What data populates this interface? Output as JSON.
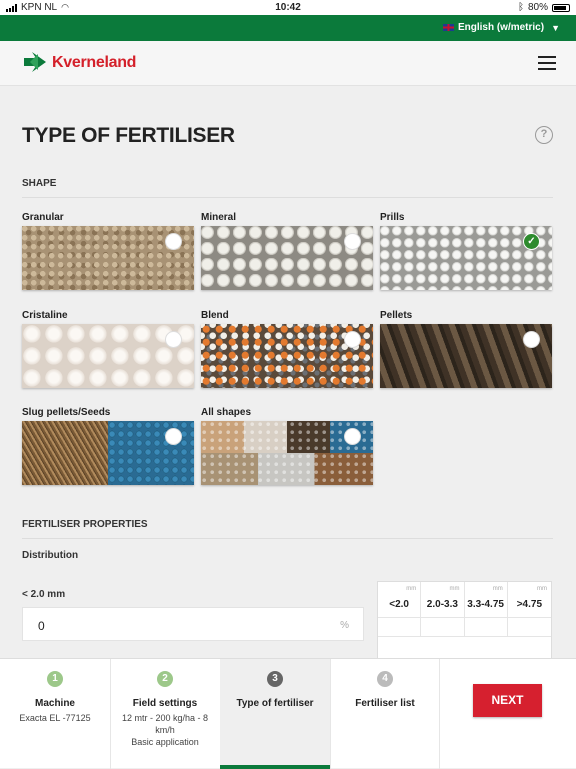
{
  "status_bar": {
    "carrier": "KPN NL",
    "time": "10:42",
    "battery": "80%"
  },
  "language": {
    "label": "English (w/metric)"
  },
  "brand": {
    "name": "Kverneland"
  },
  "page": {
    "title": "TYPE OF FERTILISER",
    "help": "?"
  },
  "shape_section": {
    "heading": "SHAPE",
    "options": [
      {
        "label": "Granular",
        "selected": false
      },
      {
        "label": "Mineral",
        "selected": false
      },
      {
        "label": "Prills",
        "selected": true
      },
      {
        "label": "Cristaline",
        "selected": false
      },
      {
        "label": "Blend",
        "selected": false
      },
      {
        "label": "Pellets",
        "selected": false
      },
      {
        "label": "Slug pellets/Seeds",
        "selected": false
      },
      {
        "label": "All shapes",
        "selected": false
      }
    ]
  },
  "properties": {
    "heading": "FERTILISER PROPERTIES",
    "distribution_label": "Distribution",
    "field_label": "< 2.0 mm",
    "field_value": "0",
    "field_unit": "%",
    "table": {
      "unit": "mm",
      "columns": [
        "<2.0",
        "2.0-3.3",
        "3.3-4.75",
        ">4.75"
      ]
    }
  },
  "steps": [
    {
      "num": "1",
      "title": "Machine",
      "detail": "Exacta EL -77125",
      "state": "done"
    },
    {
      "num": "2",
      "title": "Field settings",
      "detail": "12 mtr - 200 kg/ha - 8 km/h",
      "detail2": "Basic application",
      "state": "done"
    },
    {
      "num": "3",
      "title": "Type of fertiliser",
      "detail": "",
      "state": "current"
    },
    {
      "num": "4",
      "title": "Fertiliser list",
      "detail": "",
      "state": "todo"
    }
  ],
  "next_button": {
    "label": "NEXT"
  },
  "colors": {
    "brand_green": "#0b7a3b",
    "brand_red": "#d4202a",
    "next_red": "#d6202f",
    "check_green": "#2e8b2e"
  }
}
